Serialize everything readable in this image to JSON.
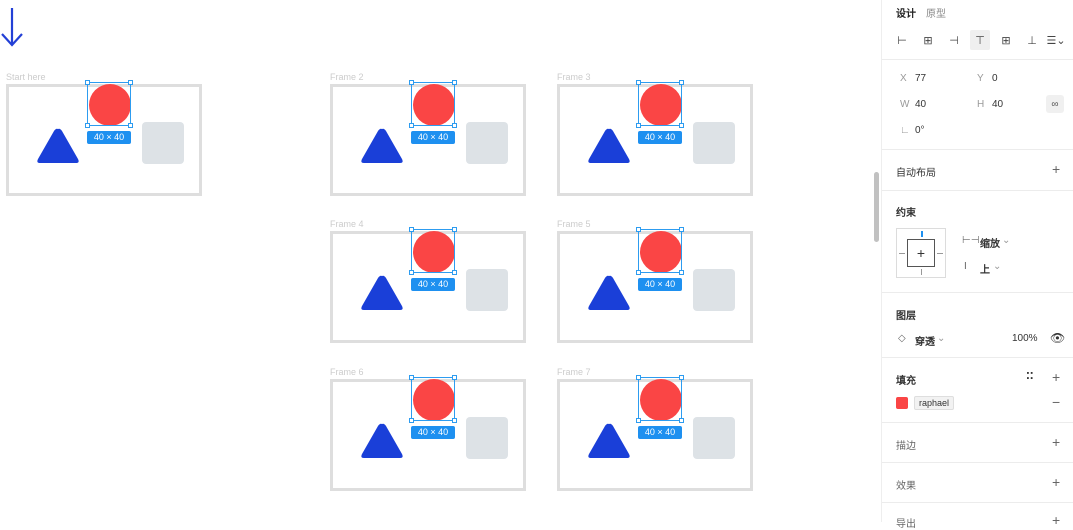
{
  "canvas": {
    "frames": [
      {
        "label": "Start here",
        "size_badge": "40 × 40"
      },
      {
        "label": "Frame 2",
        "size_badge": "40 × 40"
      },
      {
        "label": "Frame 3",
        "size_badge": "40 × 40"
      },
      {
        "label": "Frame 4",
        "size_badge": "40 × 40"
      },
      {
        "label": "Frame 5",
        "size_badge": "40 × 40"
      },
      {
        "label": "Frame 6",
        "size_badge": "40 × 40"
      },
      {
        "label": "Frame 7",
        "size_badge": "40 × 40"
      }
    ],
    "colors": {
      "circle": "#fa4545",
      "triangle": "#1a3fd8",
      "square": "#dde2e6",
      "selection": "#1e90f0",
      "arrow": "#2340d6"
    }
  },
  "panel": {
    "tabs": {
      "design": "设计",
      "prototype": "原型"
    },
    "position": {
      "x_label": "X",
      "x_value": "77",
      "y_label": "Y",
      "y_value": "0",
      "w_label": "W",
      "w_value": "40",
      "h_label": "H",
      "h_value": "40",
      "rotation_value": "0°"
    },
    "auto_layout": {
      "title": "自动布局"
    },
    "constraints": {
      "title": "约束",
      "horizontal": "缩放",
      "vertical": "上"
    },
    "layer": {
      "title": "图层",
      "blend_mode": "穿透",
      "opacity": "100%"
    },
    "fill": {
      "title": "填充",
      "style_name": "raphael",
      "color": "#fa4545"
    },
    "stroke": {
      "title": "描边"
    },
    "effects": {
      "title": "效果"
    },
    "export": {
      "title": "导出"
    }
  }
}
